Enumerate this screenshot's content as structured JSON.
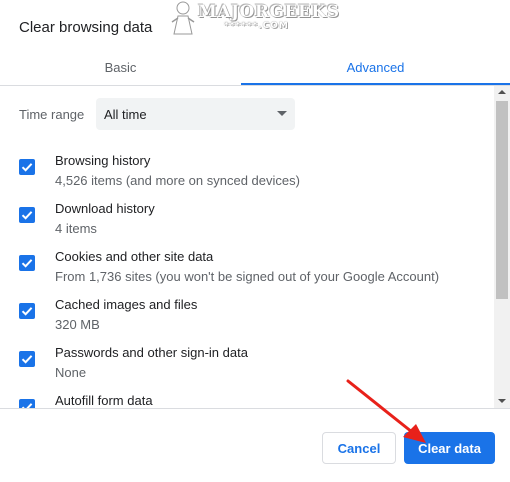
{
  "dialog": {
    "title": "Clear browsing data"
  },
  "watermark": {
    "brand": "MAJORGEEKS",
    "sub": "******.COM"
  },
  "tabs": [
    {
      "label": "Basic",
      "selected": false
    },
    {
      "label": "Advanced",
      "selected": true
    }
  ],
  "time_range": {
    "label": "Time range",
    "value": "All time"
  },
  "items": [
    {
      "title": "Browsing history",
      "subtitle": "4,526 items (and more on synced devices)",
      "checked": true
    },
    {
      "title": "Download history",
      "subtitle": "4 items",
      "checked": true
    },
    {
      "title": "Cookies and other site data",
      "subtitle": "From 1,736 sites (you won't be signed out of your Google Account)",
      "checked": true
    },
    {
      "title": "Cached images and files",
      "subtitle": "320 MB",
      "checked": true
    },
    {
      "title": "Passwords and other sign-in data",
      "subtitle": "None",
      "checked": true
    },
    {
      "title": "Autofill form data",
      "subtitle": "",
      "checked": true
    }
  ],
  "buttons": {
    "cancel": "Cancel",
    "clear": "Clear data"
  },
  "colors": {
    "accent": "#1a73e8",
    "annotation_arrow": "#e8211a"
  }
}
